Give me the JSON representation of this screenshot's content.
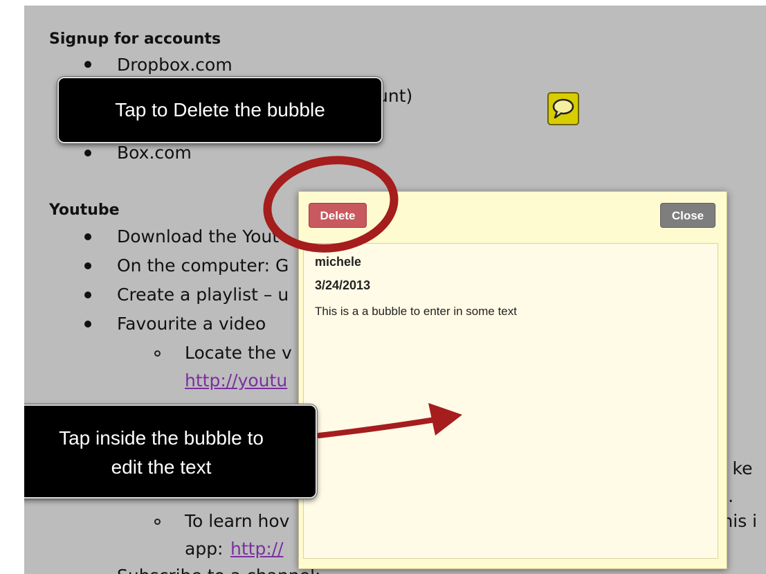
{
  "document": {
    "signup_heading": "Signup for accounts",
    "signup_items": [
      "Dropbox.com",
      "unt)",
      "Box.com"
    ],
    "youtube_heading": "Youtube",
    "youtube_items": [
      "Download the Yout",
      "On the computer: G",
      "Create a playlist – u",
      "Favourite a video"
    ],
    "sub_item_1": "Locate the v",
    "link_1": "http://youtu",
    "partial_right_1": "site: ke",
    "partial_right_2": "iPad.",
    "sub_item_2_prefix": "To learn hov",
    "partial_right_3": "er this i",
    "app_label": "app:",
    "link_2": "http://",
    "bottom_cut": "Subscribe to a channel:"
  },
  "comment_icon": {
    "icon": "speech-bubble-icon",
    "color": "#d8cd00"
  },
  "bubble": {
    "delete_label": "Delete",
    "close_label": "Close",
    "author": "michele",
    "date": "3/24/2013",
    "text": "This is a a bubble to enter in some text"
  },
  "callouts": {
    "delete_tip": "Tap to Delete the bubble",
    "edit_tip_line1": "Tap inside the bubble to",
    "edit_tip_line2": "edit the text"
  },
  "colors": {
    "background": "#bcbcbc",
    "annotation_red": "#a51d1d",
    "delete_button": "#c8595e",
    "close_button": "#7e7e7e",
    "bubble_fill": "#fffbd0"
  }
}
